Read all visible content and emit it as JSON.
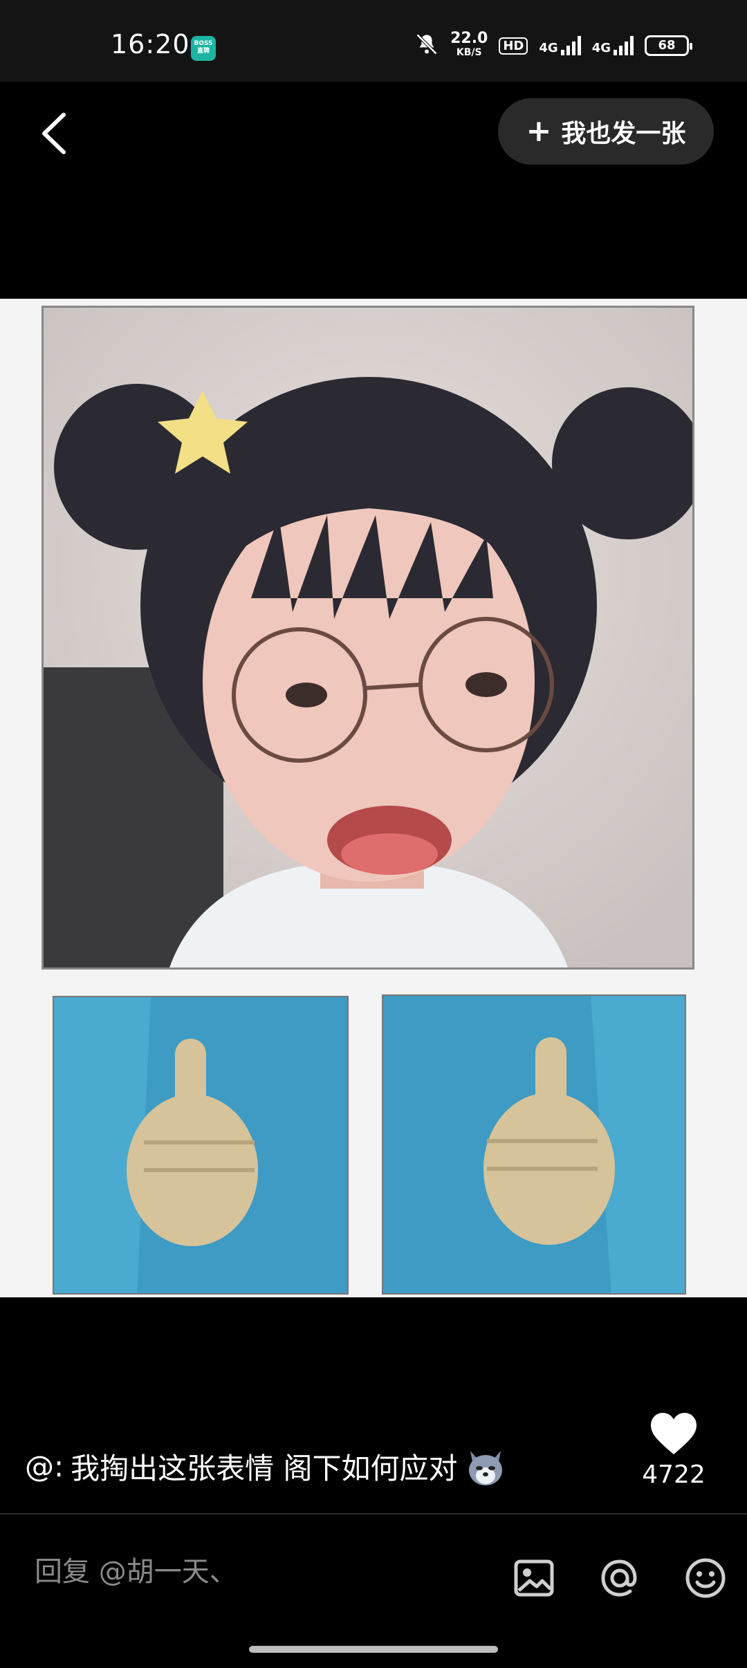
{
  "status_bar": {
    "time": "16:20",
    "app_badge": "BOSS直聘",
    "net_speed_value": "22.0",
    "net_speed_unit": "KB/S",
    "hd": "HD",
    "sim1": "4G",
    "sim2": "4G",
    "battery": "68"
  },
  "header": {
    "post_label": "我也发一张"
  },
  "caption": {
    "prefix": "@:",
    "text": "我掏出这张表情 阁下如何应对"
  },
  "like": {
    "count": "4722"
  },
  "reply": {
    "placeholder": "回复 @胡一天、"
  },
  "icons": {
    "back": "chevron-left-icon",
    "add": "plus-icon",
    "like": "heart-icon",
    "image": "image-icon",
    "mention": "at-icon",
    "emoji": "smiley-icon",
    "emoji_in_caption": "wolf-emoji"
  }
}
